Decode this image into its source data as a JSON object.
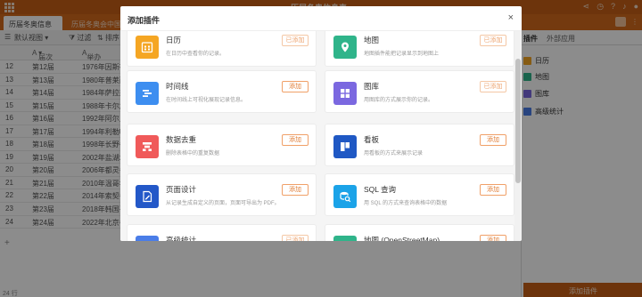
{
  "app": {
    "title": "历届冬奥信息表",
    "title_caret": "▾",
    "grid_icon": "grid-icon"
  },
  "topbar_right": {
    "icons": [
      "share-icon",
      "clock-icon",
      "question-icon",
      "bell-icon",
      "avatar-icon"
    ]
  },
  "tabs": [
    {
      "label": "历届冬奥信息"
    },
    {
      "label": "历届冬奥会中国代表团"
    }
  ],
  "tabbar_right": {
    "btn": "",
    "more": "⋮"
  },
  "toolbar": {
    "view_label": "默认视图",
    "filter_label": "过滤",
    "sort_label": "排序"
  },
  "table": {
    "headers": [
      "",
      "届次",
      "举办"
    ],
    "rows": [
      [
        "12",
        "第12届",
        "1976年因斯布"
      ],
      [
        "13",
        "第13届",
        "1980年普莱西"
      ],
      [
        "14",
        "第14届",
        "1984年萨拉热"
      ],
      [
        "15",
        "第15届",
        "1988年卡尔加"
      ],
      [
        "16",
        "第16届",
        "1992年阿尔贝"
      ],
      [
        "17",
        "第17届",
        "1994年利勒哈"
      ],
      [
        "18",
        "第18届",
        "1998年长野冬"
      ],
      [
        "19",
        "第19届",
        "2002年盐湖城"
      ],
      [
        "20",
        "第20届",
        "2006年都灵冬"
      ],
      [
        "21",
        "第21届",
        "2010年温哥华"
      ],
      [
        "22",
        "第22届",
        "2014年索契冬"
      ],
      [
        "23",
        "第23届",
        "2018年韩国平"
      ],
      [
        "24",
        "第24届",
        "2022年北京冬"
      ]
    ],
    "add_row": "+",
    "row_count": "24 行"
  },
  "right_panel": {
    "tabs": [
      "插件",
      "外部应用"
    ],
    "items": [
      "日历",
      "地图",
      "图库",
      "高级统计"
    ],
    "add_button": "添加插件"
  },
  "modal": {
    "title": "添加插件",
    "close": "×",
    "plugins": [
      {
        "name": "日历",
        "desc": "在日历中查看你的记录。",
        "button": "已添加",
        "added": true,
        "icon": "calendar-icon",
        "color": "#f5a623"
      },
      {
        "name": "地图",
        "desc": "地图插件能把记录显示到地图上",
        "button": "已添加",
        "added": true,
        "icon": "map-pin-icon",
        "color": "#2fb48a"
      },
      {
        "name": "时间线",
        "desc": "在时间线上可视化展现记录信息。",
        "button": "添加",
        "added": false,
        "icon": "timeline-icon",
        "color": "#3d8ef0"
      },
      {
        "name": "图库",
        "desc": "用图库的方式展示你的记录。",
        "button": "已添加",
        "added": true,
        "icon": "gallery-icon",
        "color": "#7b68e0"
      },
      {
        "name": "数据去重",
        "desc": "删除表格中的重复数据",
        "button": "添加",
        "added": false,
        "icon": "dedupe-icon",
        "color": "#f05a5a"
      },
      {
        "name": "看板",
        "desc": "用看板的方式来展示记录",
        "button": "添加",
        "added": false,
        "icon": "kanban-icon",
        "color": "#1f58c4"
      },
      {
        "name": "页面设计",
        "desc": "从记录生成自定义的页面，页面可导出为 PDF。",
        "button": "添加",
        "added": false,
        "icon": "page-design-icon",
        "color": "#2358c8"
      },
      {
        "name": "SQL 查询",
        "desc": "用 SQL 的方式来查询表格中的数据",
        "button": "添加",
        "added": false,
        "icon": "sql-query-icon",
        "color": "#1ba3e8"
      },
      {
        "name": "高级统计",
        "desc": "",
        "button": "已添加",
        "added": true,
        "icon": "stats-icon",
        "color": "#4a7de8"
      },
      {
        "name": "地图 (OpenStreetMap)",
        "desc": "",
        "button": "添加",
        "added": false,
        "icon": "osm-map-icon",
        "color": "#2fb48a"
      }
    ]
  }
}
